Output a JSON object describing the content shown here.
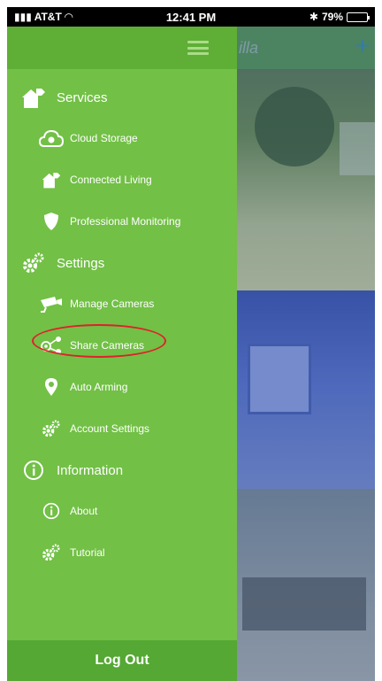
{
  "status_bar": {
    "carrier": "AT&T",
    "time": "12:41 PM",
    "battery": "79%",
    "battery_level": 0.79
  },
  "background_app": {
    "brand_partial": "illa",
    "add_symbol": "+"
  },
  "menu": {
    "sections": [
      {
        "id": "services",
        "label": "Services",
        "icon": "house-plug-icon",
        "items": [
          {
            "label": "Cloud Storage",
            "icon": "cloud-camera-icon"
          },
          {
            "label": "Connected Living",
            "icon": "house-plug-icon"
          },
          {
            "label": "Professional Monitoring",
            "icon": "shield-icon"
          }
        ]
      },
      {
        "id": "settings",
        "label": "Settings",
        "icon": "gears-icon",
        "items": [
          {
            "label": "Manage Cameras",
            "icon": "security-camera-icon"
          },
          {
            "label": "Share Cameras",
            "icon": "share-icon",
            "highlighted": true
          },
          {
            "label": "Auto Arming",
            "icon": "location-pin-icon"
          },
          {
            "label": "Account Settings",
            "icon": "gears-icon"
          }
        ]
      },
      {
        "id": "information",
        "label": "Information",
        "icon": "info-icon",
        "items": [
          {
            "label": "About",
            "icon": "info-icon"
          },
          {
            "label": "Tutorial",
            "icon": "gears-icon"
          }
        ]
      }
    ]
  },
  "logout": {
    "label": "Log Out"
  },
  "colors": {
    "drawer": "#72c046",
    "header": "#5fae36",
    "logout": "#54a833",
    "highlight": "#e0202a"
  }
}
